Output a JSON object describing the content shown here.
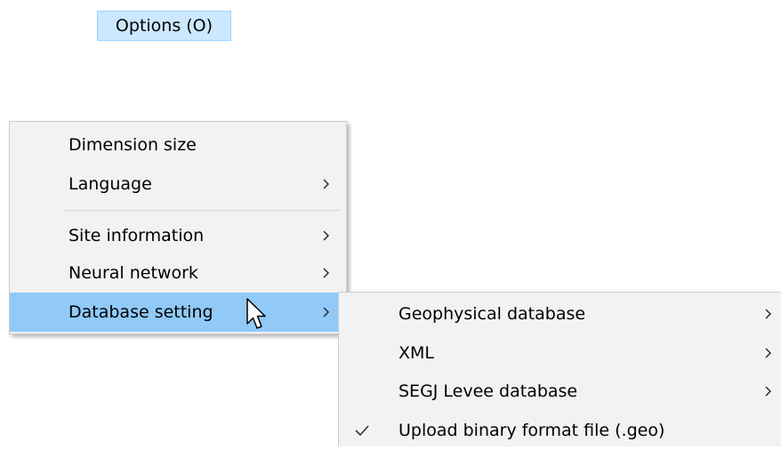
{
  "menubar": {
    "options_label": "Options (O)"
  },
  "main_menu": {
    "items": [
      {
        "label": "Dimension size",
        "has_submenu": false
      },
      {
        "label": "Language",
        "has_submenu": true
      },
      {
        "label": "Site information",
        "has_submenu": true
      },
      {
        "label": "Neural network",
        "has_submenu": true
      },
      {
        "label": "Database setting",
        "has_submenu": true,
        "highlighted": true
      }
    ]
  },
  "sub_menu": {
    "items": [
      {
        "label": "Geophysical database",
        "has_submenu": true
      },
      {
        "label": "XML",
        "has_submenu": true
      },
      {
        "label": "SEGJ Levee database",
        "has_submenu": true
      },
      {
        "label": "Upload binary format file (.geo)",
        "checked": true
      }
    ]
  },
  "colors": {
    "highlight": "#91c9f7",
    "menubar_active": "#cce8ff",
    "menu_bg": "#f2f2f2"
  },
  "icons": {
    "submenu": "chevron-right-icon",
    "checked": "checkmark-icon",
    "pointer": "mouse-cursor-icon"
  }
}
